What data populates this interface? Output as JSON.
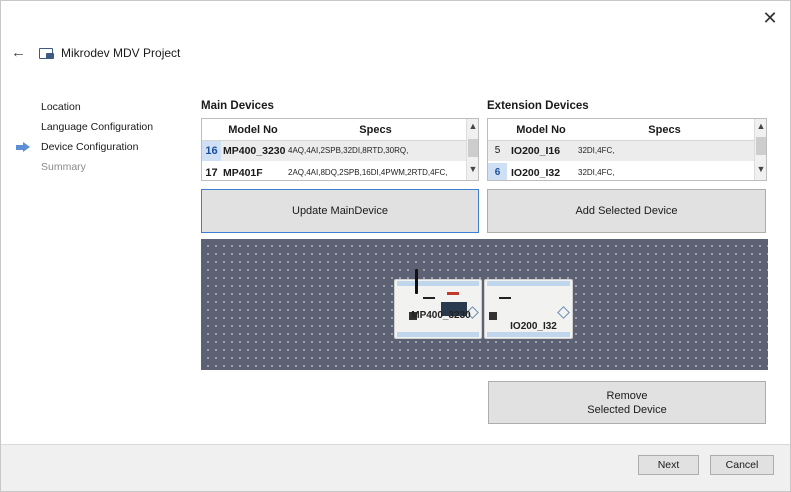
{
  "header": {
    "title": "Mikrodev MDV Project"
  },
  "steps": [
    {
      "label": "Location"
    },
    {
      "label": "Language Configuration"
    },
    {
      "label": "Device Configuration"
    },
    {
      "label": "Summary"
    }
  ],
  "main_devices": {
    "title": "Main Devices",
    "columns": [
      "Model No",
      "Specs"
    ],
    "rows": [
      {
        "num": "16",
        "model": "MP400_3230",
        "specs": "4AQ,4AI,2SPB,32DI,8RTD,30RQ,"
      },
      {
        "num": "17",
        "model": "MP401F",
        "specs": "2AQ,4AI,8DQ,2SPB,16DI,4PWM,2RTD,4FC,"
      }
    ]
  },
  "extension_devices": {
    "title": "Extension Devices",
    "columns": [
      "Model No",
      "Specs"
    ],
    "rows": [
      {
        "num": "5",
        "model": "IO200_I16",
        "specs": "32DI,4FC,"
      },
      {
        "num": "6",
        "model": "IO200_I32",
        "specs": "32DI,4FC,"
      }
    ]
  },
  "buttons": {
    "update_main": "Update MainDevice",
    "add_selected": "Add Selected Device",
    "remove_line1": "Remove",
    "remove_line2": "Selected Device",
    "next": "Next",
    "cancel": "Cancel"
  },
  "canvas": {
    "devices": [
      {
        "label": "MP400_3230"
      },
      {
        "label": "IO200_I32"
      }
    ]
  },
  "colors": {
    "accent": "#3c7fd0",
    "step_arrow": "#5b8fd6",
    "canvas_bg": "#5c6173",
    "selected_row_number": "#cfe0f5"
  },
  "icons": {
    "close": "close-icon",
    "back": "back-arrow-icon",
    "app": "project-window-icon",
    "current_step": "current-step-arrow-icon"
  }
}
